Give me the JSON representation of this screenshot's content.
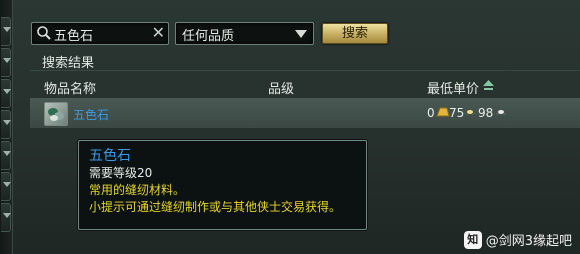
{
  "search": {
    "value": "五色石",
    "clear_label": "✕"
  },
  "quality_select": {
    "selected": "任何品质"
  },
  "search_button": {
    "label": "搜索"
  },
  "results": {
    "title": "搜索结果",
    "columns": {
      "name": "物品名称",
      "level": "品级",
      "min_price": "最低单价"
    },
    "rows": [
      {
        "name": "五色石",
        "price_gold": "0",
        "price_silver": "75",
        "price_copper": "98"
      }
    ]
  },
  "tooltip": {
    "name": "五色石",
    "requirement": "需要等级20",
    "description": "常用的缝纫材料。",
    "hint": "小提示可通过缝纫制作或与其他侠士交易获得。"
  },
  "watermark": {
    "badge": "知",
    "text": "@剑网3缘起吧"
  },
  "colors": {
    "item_name": "#3a9ae6",
    "hint": "#e9d52b",
    "button_gold": "#c9b267"
  }
}
